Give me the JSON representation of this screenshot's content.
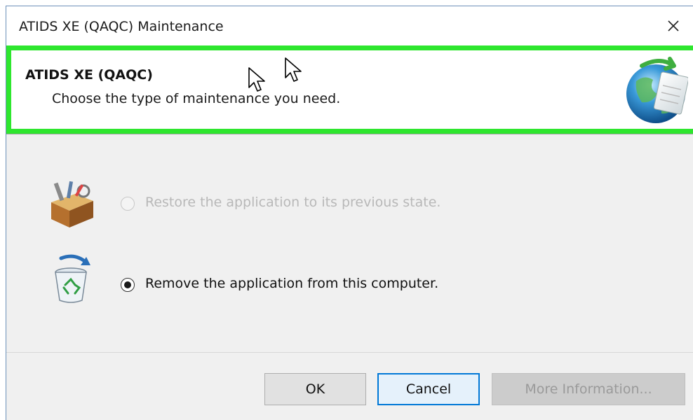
{
  "window": {
    "title": "ATIDS XE (QAQC) Maintenance"
  },
  "header": {
    "title": "ATIDS XE (QAQC)",
    "subtitle": "Choose the type of maintenance you need.",
    "highlight_color": "#2ee62e"
  },
  "options": [
    {
      "label": "Restore the application to its previous state.",
      "icon": "toolbox-icon",
      "selected": false,
      "enabled": false
    },
    {
      "label": "Remove the application from this computer.",
      "icon": "recycle-bin-icon",
      "selected": true,
      "enabled": true
    }
  ],
  "buttons": {
    "ok": "OK",
    "cancel": "Cancel",
    "more_info": "More Information..."
  },
  "colors": {
    "focus_border": "#0078d7",
    "dialog_bg": "#f0f0f0"
  }
}
